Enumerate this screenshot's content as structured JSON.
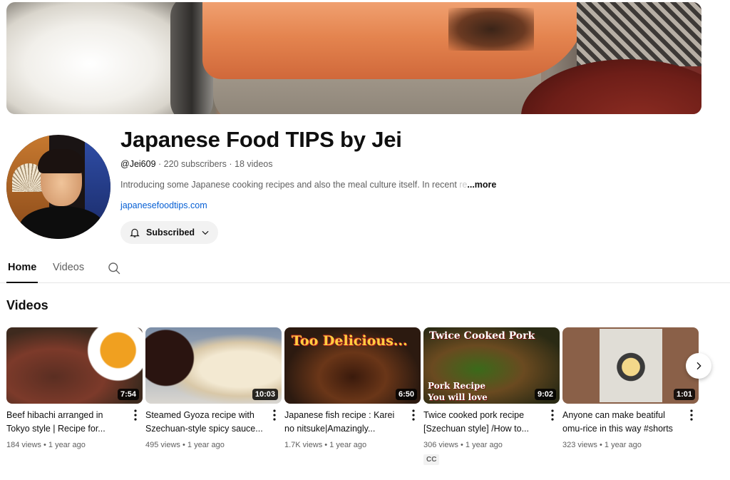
{
  "channel": {
    "title": "Japanese Food TIPS by Jei",
    "handle": "@Jei609",
    "subscribers": "220 subscribers",
    "video_count": "18 videos",
    "separator": " · ",
    "description": "Introducing some Japanese cooking recipes and also the meal culture itself. In recent",
    "description_fade": " re",
    "more_label": "...more",
    "link": "japanesefoodtips.com",
    "subscribe_label": "Subscribed"
  },
  "tabs": [
    {
      "label": "Home",
      "active": true
    },
    {
      "label": "Videos",
      "active": false
    }
  ],
  "icons": {
    "bell": "bell-icon",
    "chevron": "chevron-down-icon",
    "search": "search-icon",
    "kebab": "more-vert-icon",
    "next": "chevron-right-icon"
  },
  "section": {
    "title": "Videos"
  },
  "videos": [
    {
      "title": "Beef hibachi arranged in Tokyo style | Recipe for...",
      "duration": "7:54",
      "views": "184 views",
      "age": "1 year ago",
      "cc": ""
    },
    {
      "title": "Steamed Gyoza recipe with Szechuan-style spicy sauce...",
      "duration": "10:03",
      "views": "495 views",
      "age": "1 year ago",
      "cc": ""
    },
    {
      "title": "Japanese fish recipe : Karei no nitsuke|Amazingly...",
      "duration": "6:50",
      "views": "1.7K views",
      "age": "1 year ago",
      "cc": "",
      "thumb_text": "Too Delicious..."
    },
    {
      "title": "Twice cooked pork recipe [Szechuan style] /How to...",
      "duration": "9:02",
      "views": "306 views",
      "age": "1 year ago",
      "cc": "CC",
      "thumb_text_top": "Twice Cooked Pork",
      "thumb_text_bottom_1": "Pork Recipe",
      "thumb_text_bottom_2": "You will love"
    },
    {
      "title": "Anyone can make beatiful omu-rice in this way #shorts",
      "duration": "1:01",
      "views": "323 views",
      "age": "1 year ago",
      "cc": ""
    }
  ],
  "meta_separator": " • "
}
